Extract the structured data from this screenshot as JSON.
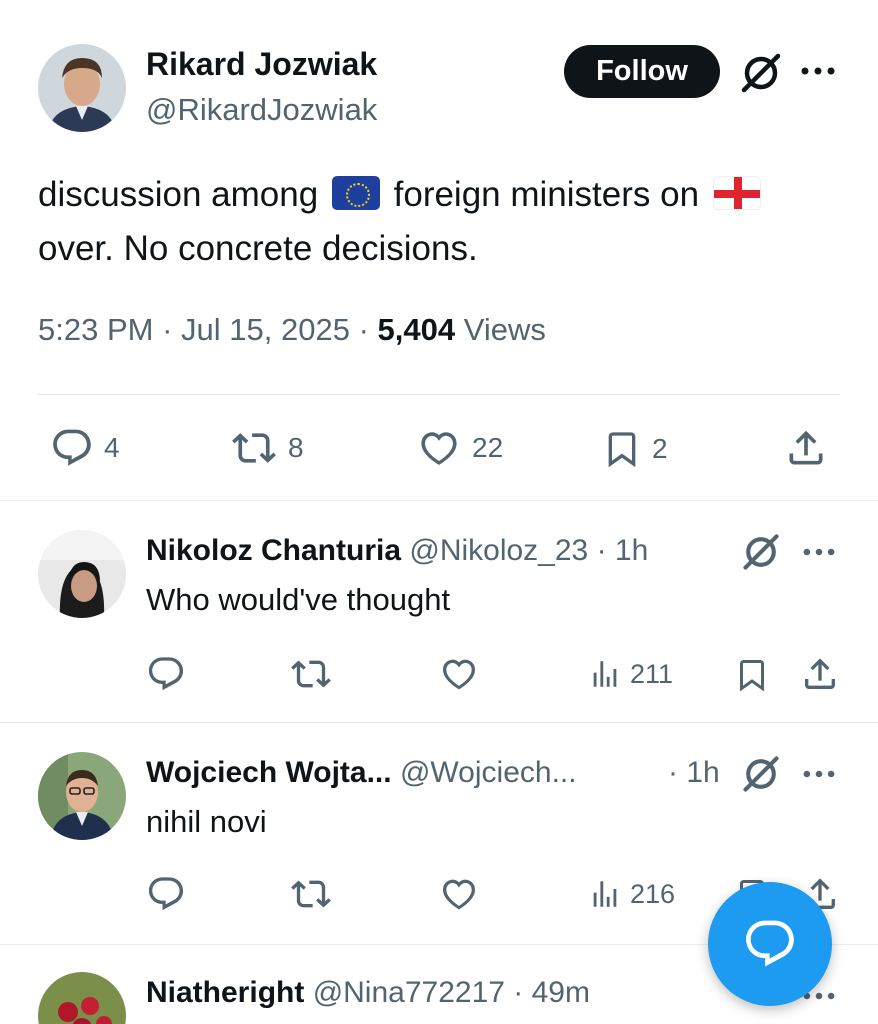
{
  "main_tweet": {
    "author_name": "Rikard Jozwiak",
    "author_handle": "@RikardJozwiak",
    "follow_label": "Follow",
    "text_part1": "discussion among",
    "flag1_icon": "eu-flag-icon",
    "text_part2": "foreign ministers on",
    "flag2_icon": "georgia-flag-icon",
    "text_part3": "over. No concrete decisions.",
    "time": "5:23 PM",
    "date": "Jul 15, 2025",
    "views_count": "5,404",
    "views_label": "Views",
    "separator": "·",
    "replies": "4",
    "reposts": "8",
    "likes": "22",
    "bookmarks": "2"
  },
  "replies": [
    {
      "name": "Nikoloz Chanturia",
      "handle": "@Nikoloz_23",
      "time": "· 1h",
      "text": "Who would've thought",
      "views": "211"
    },
    {
      "name": "Wojciech Wojta...",
      "handle": "@Wojciech...",
      "time": "· 1h",
      "text": "nihil novi",
      "views": "216"
    },
    {
      "name": "Niatheright",
      "handle": "@Nina772217",
      "time": "· 49m",
      "text": "",
      "views": ""
    }
  ],
  "colors": {
    "accent": "#1d9bf0",
    "text": "#0f1419",
    "muted": "#536471",
    "divider": "#e6ecf0"
  }
}
